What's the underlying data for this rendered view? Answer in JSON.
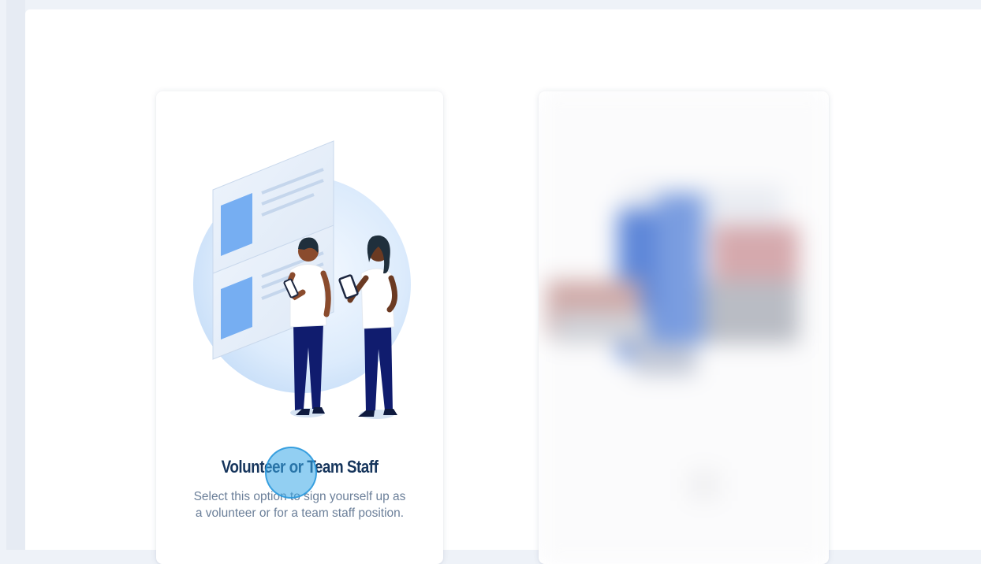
{
  "options": [
    {
      "title": "Volunteer or Team Staff",
      "description": "Select this option to sign yourself up as a volunteer or for a team staff position.",
      "illustration_icon": "volunteers-with-clipboards-illustration"
    },
    {
      "title": "",
      "description": "",
      "illustration_icon": "blurred-option-preview"
    }
  ],
  "colors": {
    "title": "#16355c",
    "description": "#6b7f99",
    "accent": "#5aa3f0",
    "uniform": "#101c6e"
  }
}
